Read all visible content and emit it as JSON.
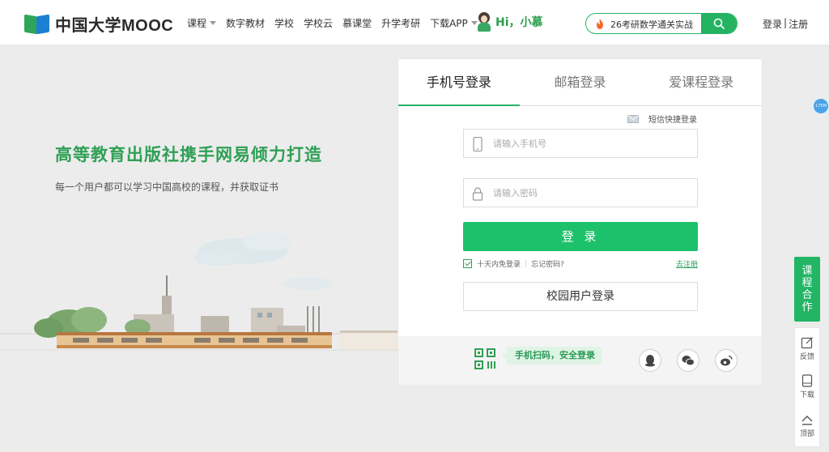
{
  "brand": {
    "name": "中国大学MOOC"
  },
  "nav": {
    "items": [
      {
        "label": "课程",
        "has_dropdown": true
      },
      {
        "label": "数字教材",
        "has_dropdown": false
      },
      {
        "label": "学校",
        "has_dropdown": false
      },
      {
        "label": "学校云",
        "has_dropdown": false
      },
      {
        "label": "慕课堂",
        "has_dropdown": false
      },
      {
        "label": "升学考研",
        "has_dropdown": false
      },
      {
        "label": "下载APP",
        "has_dropdown": true
      }
    ]
  },
  "greeting": {
    "text": "Hi，小慕"
  },
  "search": {
    "value": "26考研数学通关实战",
    "hot_icon": "fire-icon",
    "button_icon": "search-icon"
  },
  "auth": {
    "login": "登录",
    "separator": "|",
    "register": "注册"
  },
  "hero": {
    "title": "高等教育出版社携手网易倾力打造",
    "subtitle": "每一个用户都可以学习中国高校的课程，并获取证书"
  },
  "login_panel": {
    "tabs": [
      {
        "label": "手机号登录",
        "active": true
      },
      {
        "label": "邮箱登录",
        "active": false
      },
      {
        "label": "爱课程登录",
        "active": false
      }
    ],
    "sms_login": "短信快捷登录",
    "phone_placeholder": "请输入手机号",
    "password_placeholder": "请输入密码",
    "submit": "登 录",
    "remember_label": "十天内免登录",
    "remember_checked": true,
    "forgot": "忘记密码?",
    "register_link": "去注册",
    "campus_login": "校园用户登录",
    "scan_tip": "手机扫码，安全登录",
    "social": [
      "qq-icon",
      "wechat-icon",
      "weibo-icon"
    ]
  },
  "sidebar": {
    "badge": "175M",
    "cooperation": "课程合作",
    "items": [
      {
        "label": "反馈",
        "icon": "feedback-icon"
      },
      {
        "label": "下载",
        "icon": "download-icon"
      },
      {
        "label": "顶部",
        "icon": "back-to-top-icon"
      }
    ]
  },
  "colors": {
    "accent": "#1ec16b",
    "brand_green": "#2fa055",
    "brand_blue": "#1c7fd1"
  }
}
